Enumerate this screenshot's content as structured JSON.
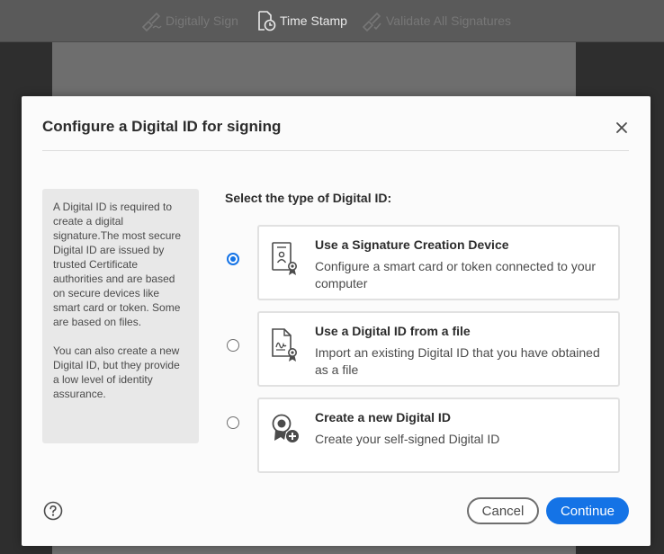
{
  "toolbar": {
    "digitally_sign": "Digitally Sign",
    "time_stamp": "Time Stamp",
    "validate_all": "Validate All Signatures"
  },
  "dialog": {
    "title": "Configure a Digital ID for signing",
    "info_paragraph_1": "A Digital ID is required to create a digital signature.The most secure Digital ID are issued by trusted Certificate authorities and are based on secure devices like smart card or token. Some are based on files.",
    "info_paragraph_2": "You can also create a new Digital ID, but they provide a low level of identity assurance.",
    "select_label": "Select the type of Digital ID:",
    "options": [
      {
        "title": "Use a Signature Creation Device",
        "description": "Configure a smart card or token connected to your computer",
        "selected": true,
        "icon": "certificate-device-icon"
      },
      {
        "title": "Use a Digital ID from a file",
        "description": "Import an existing Digital ID that you have obtained as a file",
        "selected": false,
        "icon": "signed-file-icon"
      },
      {
        "title": "Create a new Digital ID",
        "description": "Create your self-signed Digital ID",
        "selected": false,
        "icon": "add-badge-icon"
      }
    ],
    "help_icon": "help-icon",
    "cancel_label": "Cancel",
    "continue_label": "Continue"
  },
  "colors": {
    "accent": "#1473e6",
    "dialog_bg": "#fbfbfb",
    "info_bg": "#e8e8e8"
  }
}
